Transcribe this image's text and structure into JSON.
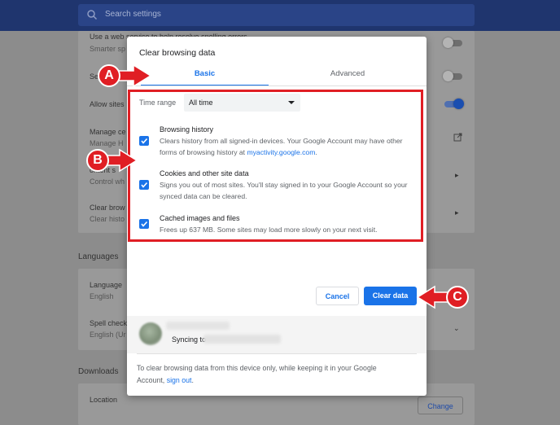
{
  "search": {
    "placeholder": "Search settings"
  },
  "background": {
    "rows": [
      {
        "title": "Use a web service to help resolve spelling errors",
        "subtitle": "Smarter sp"
      },
      {
        "title": "Se"
      },
      {
        "title": "Allow sites"
      },
      {
        "title": "Manage ce",
        "subtitle": "Manage H"
      },
      {
        "title": "ontent s",
        "subtitle": "Control wh"
      },
      {
        "title": "Clear brow",
        "subtitle": "Clear histo"
      }
    ],
    "languages_heading": "Languages",
    "language_row": {
      "title": "Language",
      "subtitle": "English"
    },
    "spell_row": {
      "title": "Spell check",
      "subtitle": "English (Ur"
    },
    "downloads_heading": "Downloads",
    "location_label": "Location",
    "change_button": "Change"
  },
  "dialog": {
    "title": "Clear browsing data",
    "tabs": [
      {
        "label": "Basic"
      },
      {
        "label": "Advanced"
      }
    ],
    "time_range": {
      "label": "Time range",
      "value": "All time"
    },
    "items": [
      {
        "title": "Browsing history",
        "desc": "Clears history from all signed-in devices. Your Google Account may have other forms of browsing history at ",
        "link": "myactivity.google.com",
        "desc_end": "."
      },
      {
        "title": "Cookies and other site data",
        "desc": "Signs you out of most sites. You'll stay signed in to your Google Account so your synced data can be cleared."
      },
      {
        "title": "Cached images and files",
        "desc": "Frees up 637 MB. Some sites may load more slowly on your next visit."
      }
    ],
    "cancel_label": "Cancel",
    "clear_label": "Clear data",
    "sync_text": "Syncing to",
    "footnote": "To clear browsing data from this device only, while keeping it in your Google Account, ",
    "footnote_link": "sign out",
    "footnote_end": "."
  },
  "markers": {
    "a": "A",
    "b": "B",
    "c": "C"
  },
  "colors": {
    "accent": "#1a73e8",
    "annotation": "#e01e24"
  }
}
